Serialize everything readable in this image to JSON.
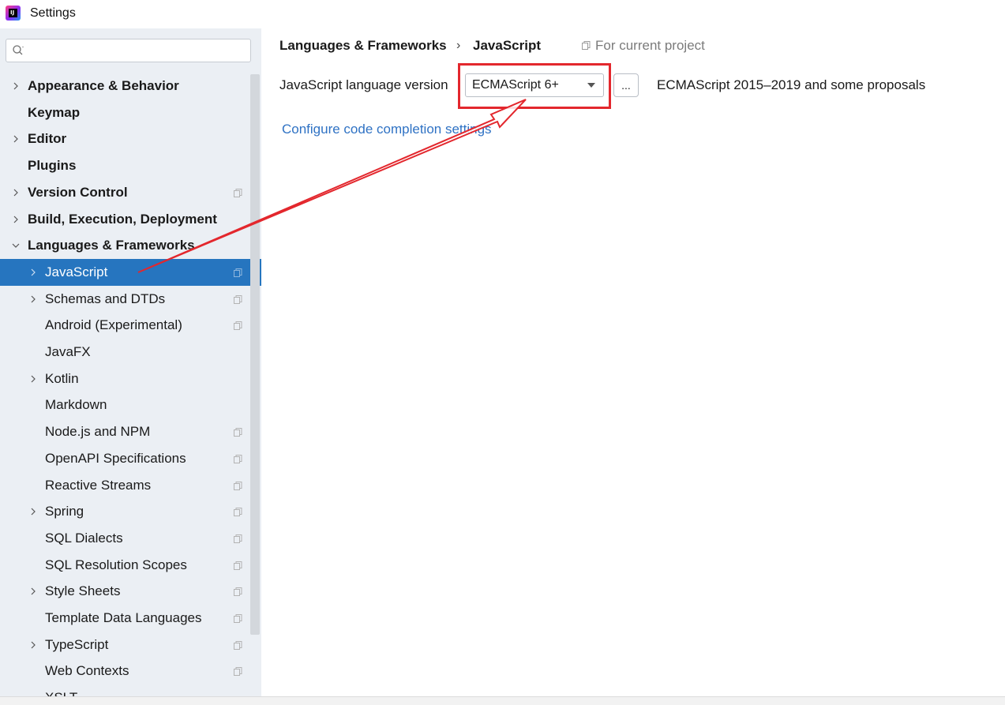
{
  "window": {
    "title": "Settings",
    "app_icon": "intellij-idea-icon"
  },
  "search": {
    "placeholder": "",
    "value": ""
  },
  "tree": [
    {
      "label": "Appearance & Behavior",
      "bold": true,
      "expandable": true,
      "indent": 0
    },
    {
      "label": "Keymap",
      "bold": true,
      "expandable": false,
      "indent": 0
    },
    {
      "label": "Editor",
      "bold": true,
      "expandable": true,
      "indent": 0
    },
    {
      "label": "Plugins",
      "bold": true,
      "expandable": false,
      "indent": 0
    },
    {
      "label": "Version Control",
      "bold": true,
      "expandable": true,
      "indent": 0,
      "project_icon": true
    },
    {
      "label": "Build, Execution, Deployment",
      "bold": true,
      "expandable": true,
      "indent": 0
    },
    {
      "label": "Languages & Frameworks",
      "bold": true,
      "expandable": true,
      "expanded": true,
      "indent": 0
    },
    {
      "label": "JavaScript",
      "bold": false,
      "expandable": true,
      "indent": 1,
      "project_icon": true,
      "selected": true
    },
    {
      "label": "Schemas and DTDs",
      "bold": false,
      "expandable": true,
      "indent": 1,
      "project_icon": true
    },
    {
      "label": "Android (Experimental)",
      "bold": false,
      "expandable": false,
      "indent": 1,
      "project_icon": true
    },
    {
      "label": "JavaFX",
      "bold": false,
      "expandable": false,
      "indent": 1
    },
    {
      "label": "Kotlin",
      "bold": false,
      "expandable": true,
      "indent": 1
    },
    {
      "label": "Markdown",
      "bold": false,
      "expandable": false,
      "indent": 1
    },
    {
      "label": "Node.js and NPM",
      "bold": false,
      "expandable": false,
      "indent": 1,
      "project_icon": true
    },
    {
      "label": "OpenAPI Specifications",
      "bold": false,
      "expandable": false,
      "indent": 1,
      "project_icon": true
    },
    {
      "label": "Reactive Streams",
      "bold": false,
      "expandable": false,
      "indent": 1,
      "project_icon": true
    },
    {
      "label": "Spring",
      "bold": false,
      "expandable": true,
      "indent": 1,
      "project_icon": true
    },
    {
      "label": "SQL Dialects",
      "bold": false,
      "expandable": false,
      "indent": 1,
      "project_icon": true
    },
    {
      "label": "SQL Resolution Scopes",
      "bold": false,
      "expandable": false,
      "indent": 1,
      "project_icon": true
    },
    {
      "label": "Style Sheets",
      "bold": false,
      "expandable": true,
      "indent": 1,
      "project_icon": true
    },
    {
      "label": "Template Data Languages",
      "bold": false,
      "expandable": false,
      "indent": 1,
      "project_icon": true
    },
    {
      "label": "TypeScript",
      "bold": false,
      "expandable": true,
      "indent": 1,
      "project_icon": true
    },
    {
      "label": "Web Contexts",
      "bold": false,
      "expandable": false,
      "indent": 1,
      "project_icon": true
    },
    {
      "label": "XSLT",
      "bold": false,
      "expandable": false,
      "indent": 1
    }
  ],
  "content": {
    "breadcrumb": {
      "parent": "Languages & Frameworks",
      "separator": "›",
      "current": "JavaScript"
    },
    "scope_label": "For current project",
    "language_version_label": "JavaScript language version",
    "language_version_value": "ECMAScript 6+",
    "more_button": "...",
    "language_version_description": "ECMAScript 2015–2019 and some proposals",
    "completion_link": "Configure code completion settings"
  },
  "colors": {
    "selection": "#2675bf",
    "sidebar_bg": "#ebeff4",
    "link": "#2f72c4",
    "annotation_red": "#e3272d"
  }
}
